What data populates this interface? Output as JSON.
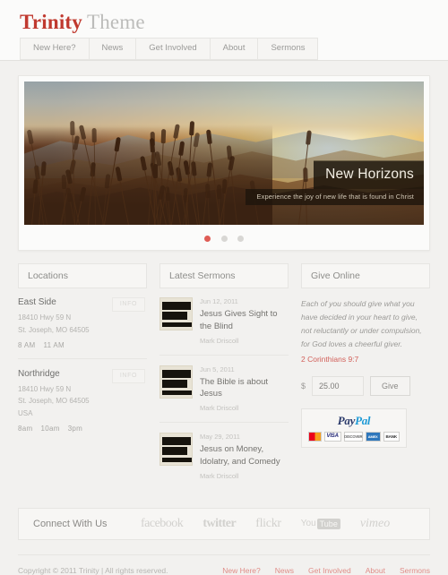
{
  "header": {
    "logo_brand": "Trinity",
    "logo_sub": "Theme",
    "nav": [
      {
        "label": "New Here?"
      },
      {
        "label": "News"
      },
      {
        "label": "Get Involved"
      },
      {
        "label": "About"
      },
      {
        "label": "Sermons"
      }
    ]
  },
  "hero": {
    "title": "New Horizons",
    "subtitle": "Experience the joy of new life that is found in Christ",
    "slides": 3,
    "active_slide": 1,
    "active_dot_color": "#df5c55"
  },
  "columns": {
    "locations": {
      "heading": "Locations",
      "info_label": "INFO",
      "items": [
        {
          "name": "East Side",
          "address1": "18410 Hwy 59 N",
          "address2": "St. Joseph, MO 64505",
          "address3": "",
          "times": [
            "8 AM",
            "11 AM"
          ]
        },
        {
          "name": "Northridge",
          "address1": "18410 Hwy 59 N",
          "address2": "St. Joseph, MO 64505",
          "address3": "USA",
          "times": [
            "8am",
            "10am",
            "3pm"
          ]
        }
      ]
    },
    "sermons": {
      "heading": "Latest Sermons",
      "thumb_text": "LUKE'S GOSPEL",
      "items": [
        {
          "date": "Jun 12, 2011",
          "title": "Jesus Gives Sight to the Blind",
          "author": "Mark Driscoll"
        },
        {
          "date": "Jun 5, 2011",
          "title": "The Bible is about Jesus",
          "author": "Mark Driscoll"
        },
        {
          "date": "May 29, 2011",
          "title": "Jesus on Money, Idolatry, and Comedy",
          "author": "Mark Driscoll"
        }
      ]
    },
    "give": {
      "heading": "Give Online",
      "quote": "Each of you should give what you have decided in your heart to give, not reluctantly or under compulsion, for God loves a cheerful giver.",
      "reference": "2 Corinthians 9:7",
      "reference_color": "#d2605a",
      "currency_symbol": "$",
      "amount_value": "25.00",
      "amount_placeholder": "0.00",
      "give_button": "Give",
      "paypal_label_pay": "Pay",
      "paypal_label_pal": "Pal",
      "cards": [
        "MasterCard",
        "VISA",
        "DISCOVER",
        "AMEX",
        "BANK"
      ]
    }
  },
  "social": {
    "label": "Connect With Us",
    "items": [
      {
        "name": "facebook"
      },
      {
        "name": "twitter"
      },
      {
        "name": "flickr"
      },
      {
        "name": "You",
        "name2": "Tube"
      },
      {
        "name": "vimeo"
      }
    ]
  },
  "footer": {
    "copyright": "Copyright © 2011 Trinity | All rights reserved.",
    "links": [
      {
        "label": "New Here?"
      },
      {
        "label": "News"
      },
      {
        "label": "Get Involved"
      },
      {
        "label": "About"
      },
      {
        "label": "Sermons"
      }
    ]
  }
}
